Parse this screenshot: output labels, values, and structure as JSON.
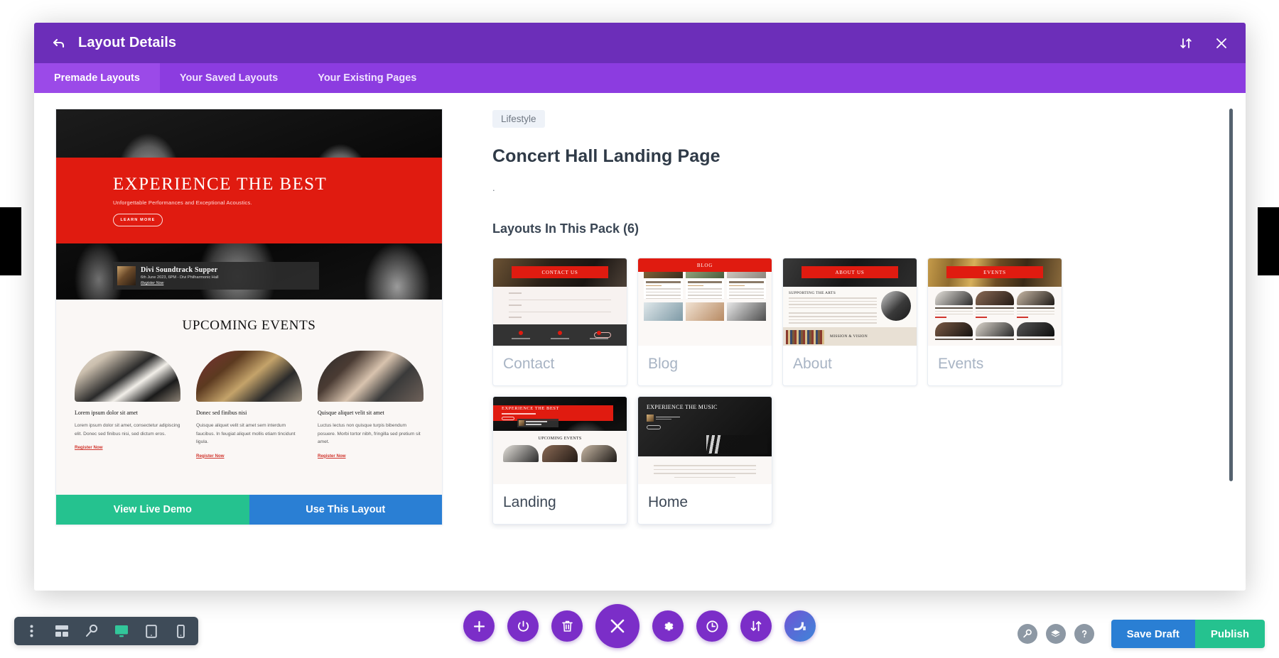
{
  "modal": {
    "title": "Layout Details",
    "back_icon": "back-arrow-icon",
    "sort_icon": "sort-updown-icon",
    "close_icon": "close-icon",
    "tabs": [
      {
        "label": "Premade Layouts",
        "active": true
      },
      {
        "label": "Your Saved Layouts",
        "active": false
      },
      {
        "label": "Your Existing Pages",
        "active": false
      }
    ]
  },
  "preview": {
    "hero": {
      "heading": "EXPERIENCE THE BEST",
      "subheading": "Unforgettable Performances and Exceptional Acoustics.",
      "button": "LEARN MORE"
    },
    "event_strip": {
      "title": "Divi Soundtrack Supper",
      "meta": "6th June 2023, 6PM - Divi Philharmonic Hall",
      "link": "Register Now"
    },
    "upcoming_heading": "UPCOMING EVENTS",
    "events": [
      {
        "name": "Lorem ipsum dolor sit amet",
        "body": "Lorem ipsum dolor sit amet, consectetur adipiscing elit. Donec sed finibus nisi, sed dictum eros.",
        "link": "Register Now"
      },
      {
        "name": "Donec sed finibus nisi",
        "body": "Quisque aliquet velit sit amet sem interdum faucibus. In feugiat aliquet mollis etiam tincidunt ligula.",
        "link": "Register Now"
      },
      {
        "name": "Quisque aliquet velit sit amet",
        "body": "Luctus lectus non quisque turpis bibendum posuere. Morbi tortor nibh, fringilla sed pretium sit amet.",
        "link": "Register Now"
      }
    ],
    "actions": {
      "demo_label": "View Live Demo",
      "use_label": "Use This Layout",
      "demo_color": "#25c28f",
      "use_color": "#2a7fd4"
    }
  },
  "detail": {
    "category": "Lifestyle",
    "title": "Concert Hall Landing Page",
    "description": ".",
    "pack_heading": "Layouts In This Pack (6)",
    "cards": [
      {
        "label": "Contact",
        "banner": "CONTACT US",
        "selected": false
      },
      {
        "label": "Blog",
        "banner": "BLOG",
        "selected": false
      },
      {
        "label": "About",
        "banner": "ABOUT US",
        "selected": false
      },
      {
        "label": "Events",
        "banner": "EVENTS",
        "selected": false
      },
      {
        "label": "Landing",
        "banner": "EXPERIENCE THE BEST",
        "selected": true
      },
      {
        "label": "Home",
        "banner": "EXPERIENCE THE MUSIC",
        "selected": true
      }
    ],
    "about_mini": {
      "heading1": "SUPPORTING THE ARTS",
      "heading2": "MISSION & VISION"
    },
    "landing_mini": {
      "upcoming": "UPCOMING EVENTS"
    }
  },
  "toolbar": {
    "left_icons": [
      "kebab-menu-icon",
      "wireframe-icon",
      "zoom-search-icon",
      "desktop-icon",
      "tablet-icon",
      "phone-icon"
    ],
    "active_left_icon": "desktop-icon",
    "center_icons": [
      "plus-icon",
      "power-icon",
      "trash-icon",
      "close-x-icon",
      "gear-icon",
      "history-clock-icon",
      "sort-updown-icon",
      "divi-logo-icon"
    ],
    "right_icons": [
      "zoom-search-icon",
      "layers-icon",
      "help-question-icon"
    ],
    "save_label": "Save Draft",
    "publish_label": "Publish",
    "save_color": "#2a7fd4",
    "publish_color": "#25c28f"
  },
  "theme": {
    "header_purple": "#6c2eb9",
    "tabbar_purple": "#8c3ce0",
    "accent_red": "#e01b10"
  }
}
